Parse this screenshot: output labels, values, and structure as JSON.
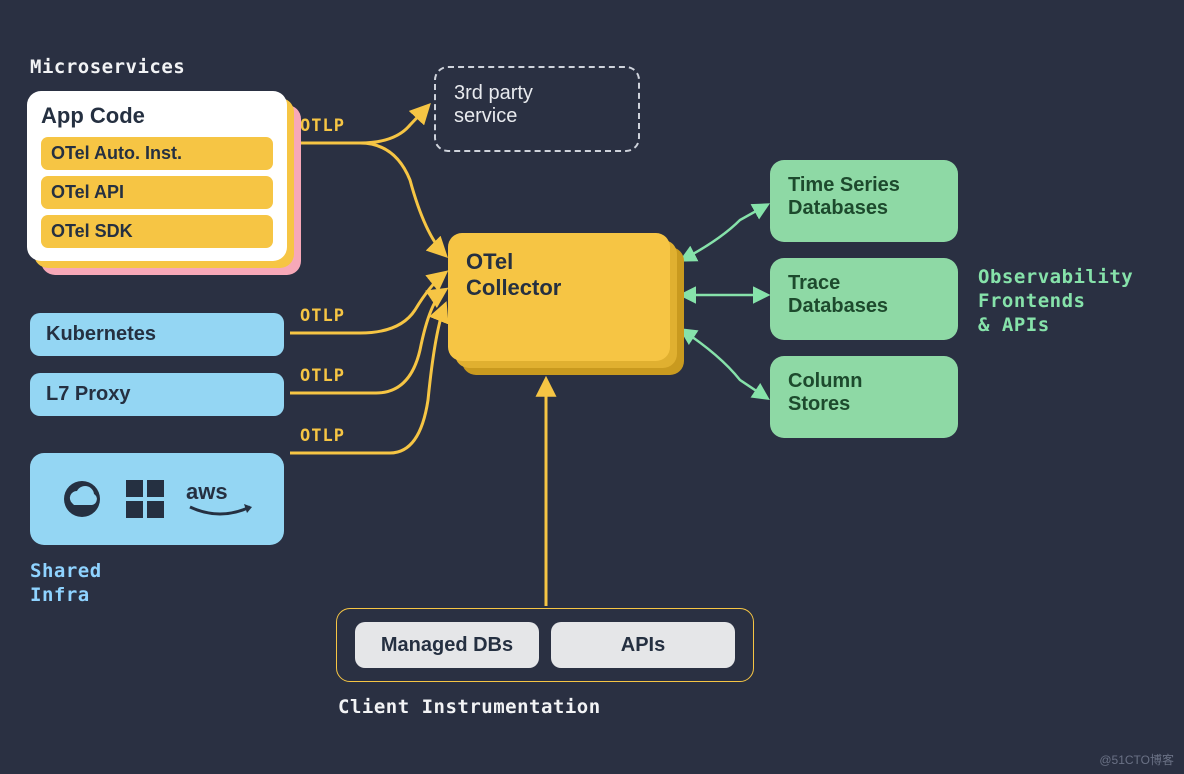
{
  "headings": {
    "microservices": "Microservices",
    "shared_infra_l1": "Shared",
    "shared_infra_l2": "Infra",
    "obs_l1": "Observability",
    "obs_l2": "Frontends",
    "obs_l3": "& APIs",
    "client_instr": "Client Instrumentation"
  },
  "app_card": {
    "title": "App Code",
    "rows": [
      "OTel Auto. Inst.",
      "OTel API",
      "OTel SDK"
    ]
  },
  "infra": {
    "kubernetes": "Kubernetes",
    "l7proxy": "L7 Proxy"
  },
  "third_party": "3rd party service",
  "collector": "OTel Collector",
  "databases": {
    "ts": "Time Series Databases",
    "trace": "Trace Databases",
    "column": "Column Stores"
  },
  "client": {
    "managed": "Managed DBs",
    "apis": "APIs"
  },
  "otlp_label": "OTLP",
  "watermark": "@51CTO博客"
}
